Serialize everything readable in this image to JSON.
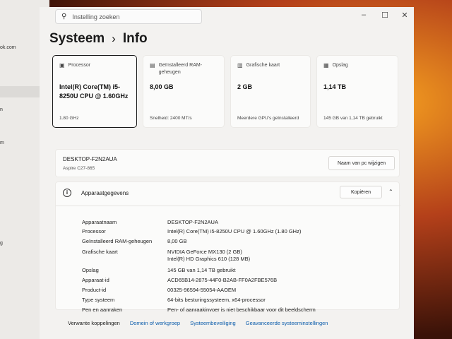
{
  "left_fragments": [
    "ok.com",
    "n",
    "m",
    "g"
  ],
  "search": {
    "placeholder": "Instelling zoeken"
  },
  "breadcrumb": {
    "parent": "Systeem",
    "separator": "›",
    "current": "Info"
  },
  "cards": [
    {
      "label": "Processor",
      "value": "Intel(R) Core(TM) i5-8250U CPU @ 1.60GHz",
      "sub": "1.80 GHz",
      "icon": "processor-icon"
    },
    {
      "label": "Geïnstalleerd RAM-geheugen",
      "value": "8,00 GB",
      "sub": "Snelheid: 2400 MT/s",
      "icon": "ram-icon"
    },
    {
      "label": "Grafische kaart",
      "value": "2 GB",
      "sub": "Meerdere GPU's geïnstalleerd",
      "icon": "gpu-icon"
    },
    {
      "label": "Opslag",
      "value": "1,14 TB",
      "sub": "145 GB van 1,14 TB gebruikt",
      "icon": "storage-icon"
    }
  ],
  "device": {
    "name": "DESKTOP-F2N2AUA",
    "model": "Aspire C27-865",
    "rename_button": "Naam van pc wijzigen"
  },
  "specs": {
    "title": "Apparaatgegevens",
    "copy_button": "Kopiëren",
    "rows": [
      {
        "k": "Apparaatnaam",
        "v": "DESKTOP-F2N2AUA"
      },
      {
        "k": "Processor",
        "v": "Intel(R) Core(TM) i5-8250U CPU @ 1.60GHz (1.80 GHz)"
      },
      {
        "k": "Geïnstalleerd RAM-geheugen",
        "v": "8,00 GB"
      },
      {
        "k": "Grafische kaart",
        "v": "NVIDIA GeForce MX130 (2 GB)",
        "v2": "Intel(R) HD Graphics 610 (128 MB)"
      },
      {
        "k": "Opslag",
        "v": "145 GB van 1,14 TB gebruikt"
      },
      {
        "k": "Apparaat-id",
        "v": "ACD65B14-2875-44F0-B2AB-FF0A2FBE576B"
      },
      {
        "k": "Product-id",
        "v": "00325-96594-55054-AAOEM"
      },
      {
        "k": "Type systeem",
        "v": "64-bits besturingssysteem, x64-processor"
      },
      {
        "k": "Pen en aanraken",
        "v": "Pen- of aanraakinvoer is niet beschikbaar voor dit beeldscherm"
      }
    ]
  },
  "related": {
    "label": "Verwante koppelingen",
    "links": [
      "Domein of werkgroep",
      "Systeembeveiliging",
      "Geavanceerde systeeminstellingen"
    ]
  }
}
